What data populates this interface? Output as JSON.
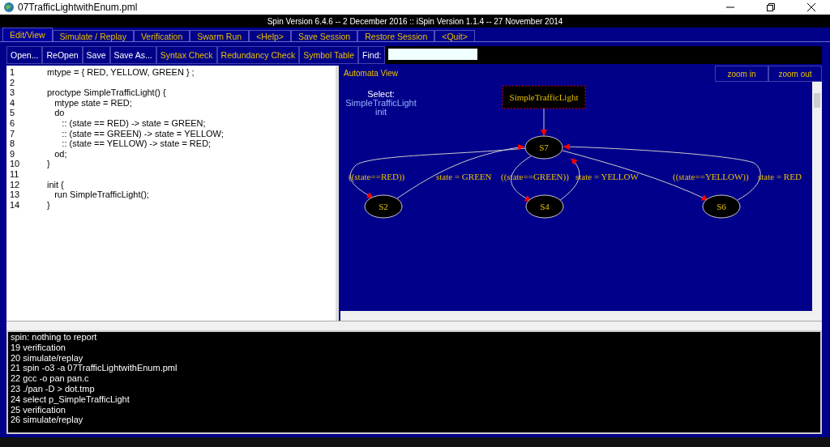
{
  "window": {
    "title": "07TrafficLightwithEnum.pml"
  },
  "version_bar": "Spin Version 6.4.6 -- 2 December 2016 :: iSpin Version 1.1.4 -- 27 November 2014",
  "tabs": [
    {
      "label": "Edit/View",
      "selected": true
    },
    {
      "label": "Simulate / Replay",
      "selected": false
    },
    {
      "label": "Verification",
      "selected": false
    },
    {
      "label": "Swarm Run",
      "selected": false
    },
    {
      "label": "<Help>",
      "selected": false
    },
    {
      "label": "Save Session",
      "selected": false
    },
    {
      "label": "Restore Session",
      "selected": false
    },
    {
      "label": "<Quit>",
      "selected": false
    }
  ],
  "toolbar": {
    "buttons": [
      "Open...",
      "ReOpen",
      "Save",
      "Save As...",
      "Syntax Check",
      "Redundancy Check",
      "Symbol Table"
    ],
    "find_label": "Find:"
  },
  "editor": {
    "lines": [
      {
        "number": "1",
        "text": "mtype = { RED, YELLOW, GREEN } ;"
      },
      {
        "number": "2"
      },
      {
        "number": "3",
        "text": "proctype SimpleTrafficLight() {"
      },
      {
        "number": "4",
        "text": "   mtype state = RED;"
      },
      {
        "number": "5",
        "text": "   do"
      },
      {
        "number": "6",
        "text": "      :: (state == RED) -> state = GREEN;"
      },
      {
        "number": "7",
        "text": "      :: (state == GREEN) -> state = YELLOW;"
      },
      {
        "number": "8",
        "text": "      :: (state == YELLOW) -> state = RED;"
      },
      {
        "number": "9",
        "text": "   od;"
      },
      {
        "number": "10",
        "text": "}"
      },
      {
        "number": "11"
      },
      {
        "number": "12",
        "text": "init {"
      },
      {
        "number": "13",
        "text": "   run SimpleTrafficLight();"
      },
      {
        "number": "14",
        "text": "}"
      }
    ]
  },
  "automata": {
    "title": "Automata View",
    "buttons": [
      "zoom in",
      "zoom out"
    ],
    "select_label": "Select:",
    "processes": [
      "SimpleTrafficLight",
      "init"
    ],
    "process_box": "SimpleTrafficLight",
    "states": [
      "S7",
      "S2",
      "S4",
      "S6"
    ],
    "edges": [
      "((state==RED))",
      "state = GREEN",
      "((state==GREEN))",
      "state = YELLOW",
      "((state==YELLOW))",
      "state = RED"
    ]
  },
  "console": {
    "lines": [
      "spin: nothing to report",
      "19 verification",
      "20 simulate/replay",
      "21 spin -o3 -a 07TrafficLightwithEnum.pml",
      "22 gcc -o pan pan.c",
      "23 ./pan -D > dot.tmp",
      "24 select p_SimpleTrafficLight",
      "25 verification",
      "26 simulate/replay"
    ]
  }
}
